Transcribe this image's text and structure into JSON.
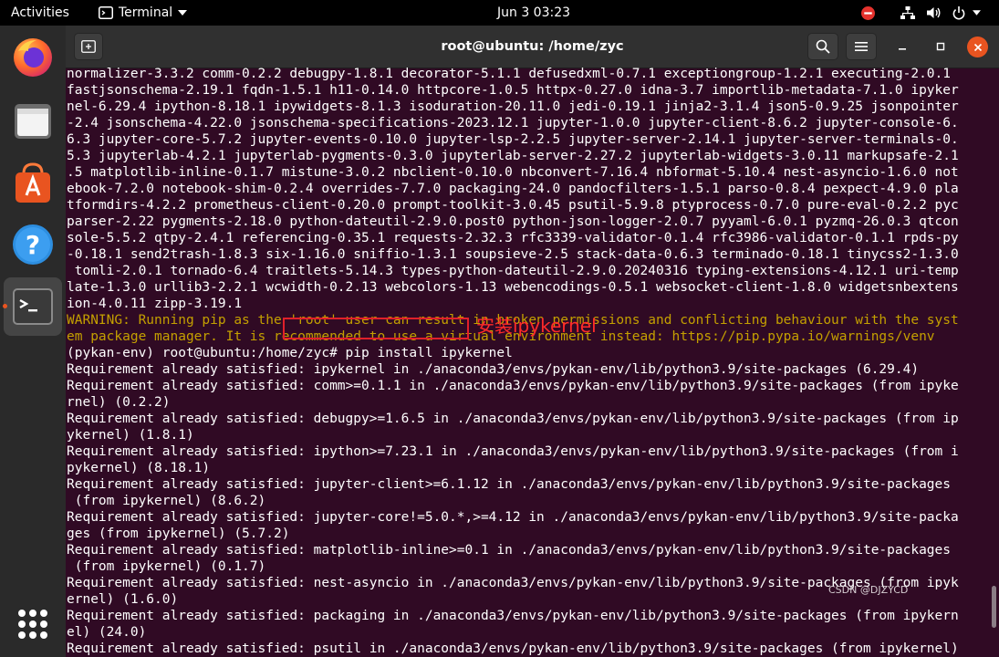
{
  "topbar": {
    "activities": "Activities",
    "app_name": "Terminal",
    "clock": "Jun 3  03:23"
  },
  "window": {
    "title": "root@ubuntu: /home/zyc"
  },
  "terminal": {
    "lines": [
      {
        "text": "normalizer-3.3.2 comm-0.2.2 debugpy-1.8.1 decorator-5.1.1 defusedxml-0.7.1 exceptiongroup-1.2.1 executing-2.0.1",
        "type": "normal"
      },
      {
        "text": "fastjsonschema-2.19.1 fqdn-1.5.1 h11-0.14.0 httpcore-1.0.5 httpx-0.27.0 idna-3.7 importlib-metadata-7.1.0 ipyker",
        "type": "normal"
      },
      {
        "text": "nel-6.29.4 ipython-8.18.1 ipywidgets-8.1.3 isoduration-20.11.0 jedi-0.19.1 jinja2-3.1.4 json5-0.9.25 jsonpointer",
        "type": "normal"
      },
      {
        "text": "-2.4 jsonschema-4.22.0 jsonschema-specifications-2023.12.1 jupyter-1.0.0 jupyter-client-8.6.2 jupyter-console-6.",
        "type": "normal"
      },
      {
        "text": "6.3 jupyter-core-5.7.2 jupyter-events-0.10.0 jupyter-lsp-2.2.5 jupyter-server-2.14.1 jupyter-server-terminals-0.",
        "type": "normal"
      },
      {
        "text": "5.3 jupyterlab-4.2.1 jupyterlab-pygments-0.3.0 jupyterlab-server-2.27.2 jupyterlab-widgets-3.0.11 markupsafe-2.1",
        "type": "normal"
      },
      {
        "text": ".5 matplotlib-inline-0.1.7 mistune-3.0.2 nbclient-0.10.0 nbconvert-7.16.4 nbformat-5.10.4 nest-asyncio-1.6.0 not",
        "type": "normal"
      },
      {
        "text": "ebook-7.2.0 notebook-shim-0.2.4 overrides-7.7.0 packaging-24.0 pandocfilters-1.5.1 parso-0.8.4 pexpect-4.9.0 pla",
        "type": "normal"
      },
      {
        "text": "tformdirs-4.2.2 prometheus-client-0.20.0 prompt-toolkit-3.0.45 psutil-5.9.8 ptyprocess-0.7.0 pure-eval-0.2.2 pyc",
        "type": "normal"
      },
      {
        "text": "parser-2.22 pygments-2.18.0 python-dateutil-2.9.0.post0 python-json-logger-2.0.7 pyyaml-6.0.1 pyzmq-26.0.3 qtcon",
        "type": "normal"
      },
      {
        "text": "sole-5.5.2 qtpy-2.4.1 referencing-0.35.1 requests-2.32.3 rfc3339-validator-0.1.4 rfc3986-validator-0.1.1 rpds-py",
        "type": "normal"
      },
      {
        "text": "-0.18.1 send2trash-1.8.3 six-1.16.0 sniffio-1.3.1 soupsieve-2.5 stack-data-0.6.3 terminado-0.18.1 tinycss2-1.3.0",
        "type": "normal"
      },
      {
        "text": " tomli-2.0.1 tornado-6.4 traitlets-5.14.3 types-python-dateutil-2.9.0.20240316 typing-extensions-4.12.1 uri-temp",
        "type": "normal"
      },
      {
        "text": "late-1.3.0 urllib3-2.2.1 wcwidth-0.2.13 webcolors-1.13 webencodings-0.5.1 websocket-client-1.8.0 widgetsnbextens",
        "type": "normal"
      },
      {
        "text": "ion-4.0.11 zipp-3.19.1",
        "type": "normal"
      },
      {
        "text": "WARNING: Running pip as the 'root' user can result in broken permissions and conflicting behaviour with the syst",
        "type": "warn"
      },
      {
        "text": "em package manager. It is recommended to use a virtual environment instead: https://pip.pypa.io/warnings/venv",
        "type": "warn"
      },
      {
        "text": "(pykan-env) root@ubuntu:/home/zyc# pip install ipykernel",
        "type": "normal"
      },
      {
        "text": "Requirement already satisfied: ipykernel in ./anaconda3/envs/pykan-env/lib/python3.9/site-packages (6.29.4)",
        "type": "normal"
      },
      {
        "text": "Requirement already satisfied: comm>=0.1.1 in ./anaconda3/envs/pykan-env/lib/python3.9/site-packages (from ipyke",
        "type": "normal"
      },
      {
        "text": "rnel) (0.2.2)",
        "type": "normal"
      },
      {
        "text": "Requirement already satisfied: debugpy>=1.6.5 in ./anaconda3/envs/pykan-env/lib/python3.9/site-packages (from ip",
        "type": "normal"
      },
      {
        "text": "ykernel) (1.8.1)",
        "type": "normal"
      },
      {
        "text": "Requirement already satisfied: ipython>=7.23.1 in ./anaconda3/envs/pykan-env/lib/python3.9/site-packages (from i",
        "type": "normal"
      },
      {
        "text": "pykernel) (8.18.1)",
        "type": "normal"
      },
      {
        "text": "Requirement already satisfied: jupyter-client>=6.1.12 in ./anaconda3/envs/pykan-env/lib/python3.9/site-packages",
        "type": "normal"
      },
      {
        "text": " (from ipykernel) (8.6.2)",
        "type": "normal"
      },
      {
        "text": "Requirement already satisfied: jupyter-core!=5.0.*,>=4.12 in ./anaconda3/envs/pykan-env/lib/python3.9/site-packa",
        "type": "normal"
      },
      {
        "text": "ges (from ipykernel) (5.7.2)",
        "type": "normal"
      },
      {
        "text": "Requirement already satisfied: matplotlib-inline>=0.1 in ./anaconda3/envs/pykan-env/lib/python3.9/site-packages",
        "type": "normal"
      },
      {
        "text": " (from ipykernel) (0.1.7)",
        "type": "normal"
      },
      {
        "text": "Requirement already satisfied: nest-asyncio in ./anaconda3/envs/pykan-env/lib/python3.9/site-packages (from ipyk",
        "type": "normal"
      },
      {
        "text": "ernel) (1.6.0)",
        "type": "normal"
      },
      {
        "text": "Requirement already satisfied: packaging in ./anaconda3/envs/pykan-env/lib/python3.9/site-packages (from ipykern",
        "type": "normal"
      },
      {
        "text": "el) (24.0)",
        "type": "normal"
      },
      {
        "text": "Requirement already satisfied: psutil in ./anaconda3/envs/pykan-env/lib/python3.9/site-packages (from ipykernel)",
        "type": "normal"
      }
    ]
  },
  "annotation": {
    "text": "安装ipykernel"
  },
  "watermark": {
    "text": "CSDN @DJZYCD"
  },
  "dock": {
    "items": [
      "firefox-icon",
      "files-icon",
      "software-icon",
      "help-icon",
      "terminal-icon",
      "apps-grid-icon"
    ]
  },
  "colors": {
    "terminal_bg": "#300a24",
    "warning": "#c4a000",
    "annotation": "#e0202a",
    "headerbar": "#303030"
  }
}
